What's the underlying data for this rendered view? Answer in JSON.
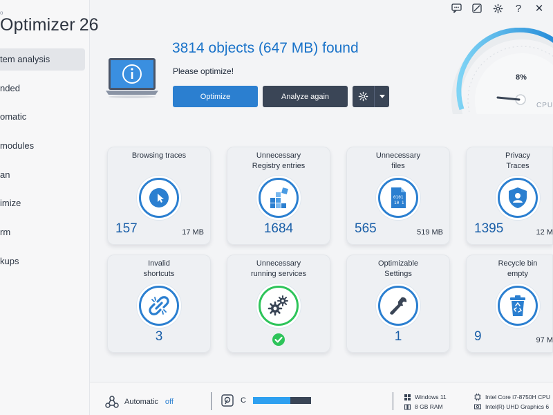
{
  "app": {
    "subtitle": "o",
    "title": "Optimizer",
    "version": "26"
  },
  "nav": [
    {
      "label": "tem analysis",
      "active": true
    },
    {
      "label": "nded",
      "active": false
    },
    {
      "label": "omatic",
      "active": false
    },
    {
      "label": "modules",
      "active": false
    },
    {
      "label": "an",
      "active": false
    },
    {
      "label": "imize",
      "active": false
    },
    {
      "label": "rm",
      "active": false
    },
    {
      "label": "kups",
      "active": false
    }
  ],
  "header": {
    "headline": "3814 objects (647 MB) found",
    "subline": "Please optimize!",
    "optimize_label": "Optimize",
    "analyze_label": "Analyze again"
  },
  "gauge": {
    "value": "8%",
    "label": "CPU",
    "level": 8
  },
  "tiles": [
    {
      "title": "Browsing traces",
      "count": "157",
      "size": "17 MB",
      "icon": "cursor-icon"
    },
    {
      "title": "Unnecessary\nRegistry entries",
      "count": "1684",
      "size": "",
      "icon": "registry-icon"
    },
    {
      "title": "Unnecessary\nfiles",
      "count": "565",
      "size": "519 MB",
      "icon": "binary-file-icon"
    },
    {
      "title": "Privacy\nTraces",
      "count": "1395",
      "size": "12 M",
      "icon": "shield-person-icon"
    },
    {
      "title": "Invalid\nshortcuts",
      "count": "3",
      "size": "",
      "icon": "broken-link-icon"
    },
    {
      "title": "Unnecessary\nrunning services",
      "count": "",
      "size": "",
      "icon": "gears-icon"
    },
    {
      "title": "Optimizable\nSettings",
      "count": "1",
      "size": "",
      "icon": "wrench-icon"
    },
    {
      "title": "Recycle bin\nempty",
      "count": "9",
      "size": "97 M",
      "icon": "recycle-bin-icon"
    }
  ],
  "footer": {
    "automatic_label": "Automatic",
    "automatic_state": "off",
    "drive_letter": "C",
    "drive_fill_fraction": 0.64,
    "os": "Windows 11",
    "ram": "8 GB RAM",
    "cpu": "Intel Core i7-8750H CPU",
    "gpu": "Intel(R) UHD Graphics 6"
  },
  "colors": {
    "accent": "#2b7fd0",
    "dark_button": "#3a4556",
    "success": "#2ec45a"
  }
}
